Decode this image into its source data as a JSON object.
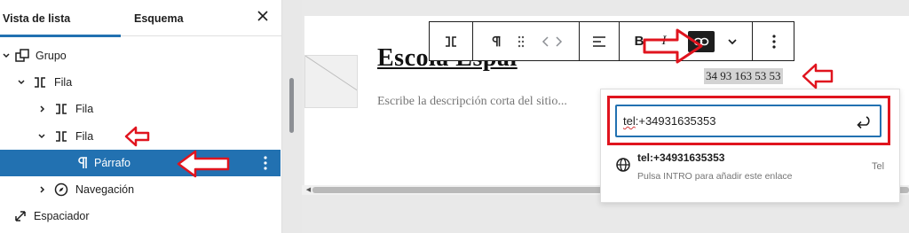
{
  "panel": {
    "tabs": [
      {
        "label": "Vista de lista",
        "active": true
      },
      {
        "label": "Esquema",
        "active": false
      }
    ],
    "close_icon": "close-icon",
    "tree": [
      {
        "label": "Grupo",
        "icon": "group-icon",
        "expanded": true,
        "level": 0
      },
      {
        "label": "Fila",
        "icon": "row-icon",
        "expanded": true,
        "level": 1
      },
      {
        "label": "Fila",
        "icon": "row-icon",
        "expanded": false,
        "level": 2
      },
      {
        "label": "Fila",
        "icon": "row-icon",
        "expanded": true,
        "level": 2
      },
      {
        "label": "Párrafo",
        "icon": "paragraph-icon",
        "selected": true,
        "level": 3
      },
      {
        "label": "Navegación",
        "icon": "navigation-icon",
        "expanded": false,
        "level": 2
      },
      {
        "label": "Espaciador",
        "icon": "spacer-icon",
        "level": 0
      }
    ]
  },
  "editor": {
    "site_title": "Escola Espai",
    "tagline": "Escribe la descripción corta del sitio...",
    "phone_text": "34 93 163 53 53"
  },
  "toolbar": {
    "buttons": [
      {
        "icon": "row-block-icon"
      },
      {
        "icon": "paragraph-icon"
      },
      {
        "icon": "drag-handle-icon"
      },
      {
        "icon": "move-arrows-icon"
      },
      {
        "icon": "align-left-icon"
      },
      {
        "label": "B",
        "icon": "bold-icon"
      },
      {
        "label": "I",
        "icon": "italic-icon"
      },
      {
        "icon": "link-icon",
        "active": true
      },
      {
        "icon": "chevron-down-icon"
      },
      {
        "icon": "more-options-icon"
      }
    ]
  },
  "link_popover": {
    "input_value_prefix": "tel",
    "input_value_rest": ":+34931635353",
    "suggestion_title": "tel:+34931635353",
    "suggestion_hint": "Pulsa INTRO para añadir este enlace",
    "suggestion_type": "Tel"
  },
  "colors": {
    "accent": "#2271b1",
    "annotation_red": "#e0141e",
    "toolbar_dark": "#1e1e1e"
  }
}
